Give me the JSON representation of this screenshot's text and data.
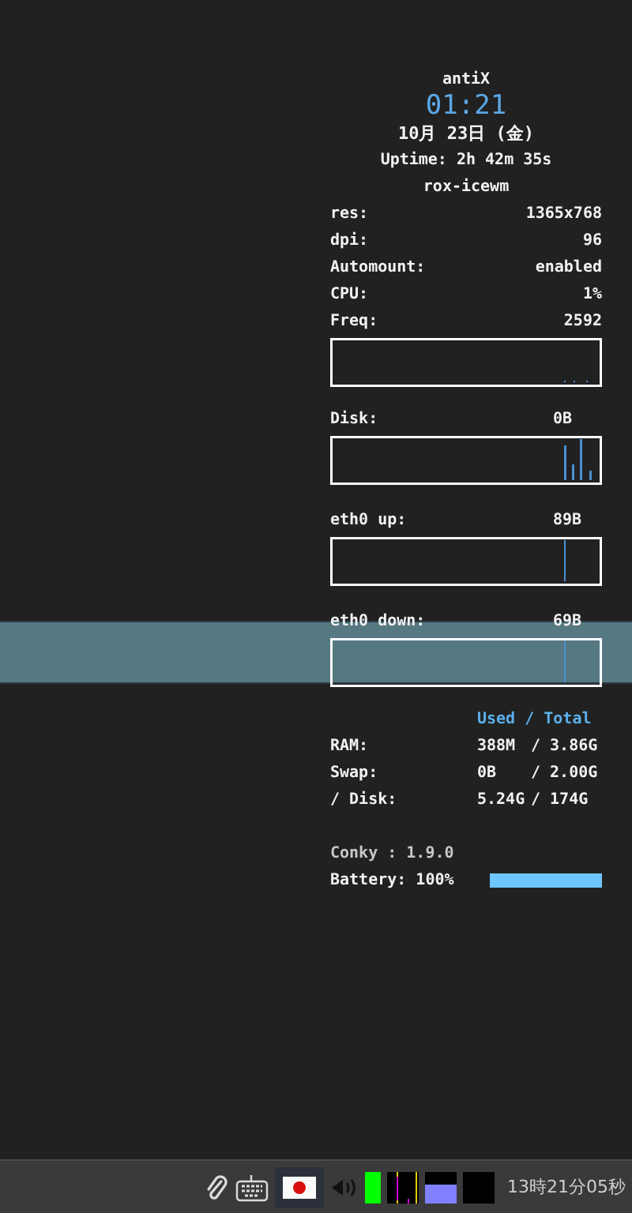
{
  "conky": {
    "title": "antiX",
    "time": "01:21",
    "date": "10月 23日 (金)",
    "uptime": "Uptime: 2h 42m 35s",
    "session": "rox-icewm",
    "stats": [
      {
        "label": "res:",
        "value": "1365x768"
      },
      {
        "label": "dpi:",
        "value": "96"
      },
      {
        "label": "Automount:",
        "value": "enabled"
      },
      {
        "label": "CPU:",
        "value": "1%"
      },
      {
        "label": "Freq:",
        "value": "2592"
      }
    ],
    "graphs": [
      {
        "label": "Disk:",
        "value": "0B"
      },
      {
        "label": "eth0 up:",
        "value": "89B"
      },
      {
        "label": "eth0 down:",
        "value": "69B"
      }
    ],
    "memory_header": "Used / Total",
    "memory": [
      {
        "label": "RAM:",
        "used": "388M",
        "total": "/ 3.86G"
      },
      {
        "label": "Swap:",
        "used": "0B",
        "total": "/ 2.00G"
      },
      {
        "label": "/ Disk:",
        "used": "5.24G",
        "total": "/ 174G"
      }
    ],
    "version": "Conky : 1.9.0",
    "battery": {
      "label": "Battery: 100%",
      "level": 1
    }
  },
  "taskbar": {
    "clock": "13時21分05秒"
  }
}
